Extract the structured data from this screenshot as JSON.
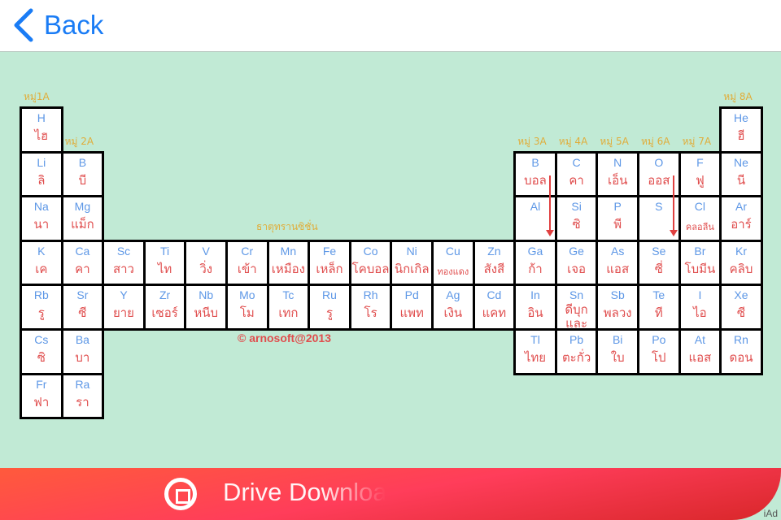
{
  "header": {
    "back_label": "Back"
  },
  "colors": {
    "accent": "#1a7cf5",
    "background": "#c1ead5",
    "symbol": "#5d97e6",
    "thai": "#e04e4e",
    "group_label": "#e0ad3a"
  },
  "group_labels": [
    {
      "text": "หมู่1A",
      "col": 1,
      "row": 1
    },
    {
      "text": "หมู่ 2A",
      "col": 2,
      "row": 2
    },
    {
      "text": "หมู่ 3A",
      "col": 13,
      "row": 2
    },
    {
      "text": "หมู่ 4A",
      "col": 14,
      "row": 2
    },
    {
      "text": "หมู่ 5A",
      "col": 15,
      "row": 2
    },
    {
      "text": "หมู่ 6A",
      "col": 16,
      "row": 2
    },
    {
      "text": "หมู่ 7A",
      "col": 17,
      "row": 2
    },
    {
      "text": "หมู่ 8A",
      "col": 18,
      "row": 1
    }
  ],
  "transition_label": "ธาตุทรานซิชั่น",
  "copyright": "© arnosoft@2013",
  "elements": [
    {
      "sym": "H",
      "th": "ไฮ",
      "col": 1,
      "row": 1
    },
    {
      "sym": "He",
      "th": "ฮี",
      "col": 18,
      "row": 1
    },
    {
      "sym": "Li",
      "th": "ลิ",
      "col": 1,
      "row": 2
    },
    {
      "sym": "B",
      "th": "บี",
      "col": 2,
      "row": 2
    },
    {
      "sym": "B",
      "th": "บอล",
      "col": 13,
      "row": 2
    },
    {
      "sym": "C",
      "th": "คา",
      "col": 14,
      "row": 2
    },
    {
      "sym": "N",
      "th": "เอ็น",
      "col": 15,
      "row": 2
    },
    {
      "sym": "O",
      "th": "ออส",
      "col": 16,
      "row": 2
    },
    {
      "sym": "F",
      "th": "ฟู",
      "col": 17,
      "row": 2
    },
    {
      "sym": "Ne",
      "th": "นี",
      "col": 18,
      "row": 2
    },
    {
      "sym": "Na",
      "th": "นา",
      "col": 1,
      "row": 3
    },
    {
      "sym": "Mg",
      "th": "แม็ก",
      "col": 2,
      "row": 3
    },
    {
      "sym": "Al",
      "th": "",
      "col": 13,
      "row": 3
    },
    {
      "sym": "Si",
      "th": "ซิ",
      "col": 14,
      "row": 3
    },
    {
      "sym": "P",
      "th": "พี",
      "col": 15,
      "row": 3
    },
    {
      "sym": "S",
      "th": "",
      "col": 16,
      "row": 3
    },
    {
      "sym": "Cl",
      "th": "คลอลีน",
      "col": 17,
      "row": 3,
      "small": true
    },
    {
      "sym": "Ar",
      "th": "อาร์",
      "col": 18,
      "row": 3
    },
    {
      "sym": "K",
      "th": "เค",
      "col": 1,
      "row": 4
    },
    {
      "sym": "Ca",
      "th": "คา",
      "col": 2,
      "row": 4
    },
    {
      "sym": "Sc",
      "th": "สาว",
      "col": 3,
      "row": 4
    },
    {
      "sym": "Ti",
      "th": "ไท",
      "col": 4,
      "row": 4
    },
    {
      "sym": "V",
      "th": "วิ่ง",
      "col": 5,
      "row": 4
    },
    {
      "sym": "Cr",
      "th": "เข้า",
      "col": 6,
      "row": 4
    },
    {
      "sym": "Mn",
      "th": "เหมือง",
      "col": 7,
      "row": 4
    },
    {
      "sym": "Fe",
      "th": "เหล็ก",
      "col": 8,
      "row": 4
    },
    {
      "sym": "Co",
      "th": "โคบอล",
      "col": 9,
      "row": 4
    },
    {
      "sym": "Ni",
      "th": "นิกเกิล",
      "col": 10,
      "row": 4
    },
    {
      "sym": "Cu",
      "th": "ทองแดง",
      "col": 11,
      "row": 4,
      "small": true
    },
    {
      "sym": "Zn",
      "th": "สังสี",
      "col": 12,
      "row": 4
    },
    {
      "sym": "Ga",
      "th": "ก้า",
      "col": 13,
      "row": 4
    },
    {
      "sym": "Ge",
      "th": "เจอ",
      "col": 14,
      "row": 4
    },
    {
      "sym": "As",
      "th": "แอส",
      "col": 15,
      "row": 4
    },
    {
      "sym": "Se",
      "th": "ซี่",
      "col": 16,
      "row": 4
    },
    {
      "sym": "Br",
      "th": "โบมีน",
      "col": 17,
      "row": 4
    },
    {
      "sym": "Kr",
      "th": "คลิบ",
      "col": 18,
      "row": 4
    },
    {
      "sym": "Rb",
      "th": "รู",
      "col": 1,
      "row": 5
    },
    {
      "sym": "Sr",
      "th": "ซี",
      "col": 2,
      "row": 5
    },
    {
      "sym": "Y",
      "th": "ยาย",
      "col": 3,
      "row": 5
    },
    {
      "sym": "Zr",
      "th": "เซอร์",
      "col": 4,
      "row": 5
    },
    {
      "sym": "Nb",
      "th": "หนีบ",
      "col": 5,
      "row": 5
    },
    {
      "sym": "Mo",
      "th": "โม",
      "col": 6,
      "row": 5
    },
    {
      "sym": "Tc",
      "th": "เทก",
      "col": 7,
      "row": 5
    },
    {
      "sym": "Ru",
      "th": "รู",
      "col": 8,
      "row": 5
    },
    {
      "sym": "Rh",
      "th": "โร",
      "col": 9,
      "row": 5
    },
    {
      "sym": "Pd",
      "th": "แพท",
      "col": 10,
      "row": 5
    },
    {
      "sym": "Ag",
      "th": "เงิน",
      "col": 11,
      "row": 5
    },
    {
      "sym": "Cd",
      "th": "แคท",
      "col": 12,
      "row": 5
    },
    {
      "sym": "In",
      "th": "อิน",
      "col": 13,
      "row": 5
    },
    {
      "sym": "Sn",
      "th": "ดีบุกและ",
      "col": 14,
      "row": 5,
      "wrap": true
    },
    {
      "sym": "Sb",
      "th": "พลวง",
      "col": 15,
      "row": 5
    },
    {
      "sym": "Te",
      "th": "ที",
      "col": 16,
      "row": 5
    },
    {
      "sym": "I",
      "th": "ไอ",
      "col": 17,
      "row": 5
    },
    {
      "sym": "Xe",
      "th": "ซี",
      "col": 18,
      "row": 5
    },
    {
      "sym": "Cs",
      "th": "ซิ",
      "col": 1,
      "row": 6
    },
    {
      "sym": "Ba",
      "th": "บา",
      "col": 2,
      "row": 6
    },
    {
      "sym": "Tl",
      "th": "ไทย",
      "col": 13,
      "row": 6
    },
    {
      "sym": "Pb",
      "th": "ตะกั่ว",
      "col": 14,
      "row": 6
    },
    {
      "sym": "Bi",
      "th": "ใบ",
      "col": 15,
      "row": 6
    },
    {
      "sym": "Po",
      "th": "โป",
      "col": 16,
      "row": 6
    },
    {
      "sym": "At",
      "th": "แอส",
      "col": 17,
      "row": 6
    },
    {
      "sym": "Rn",
      "th": "ดอน",
      "col": 18,
      "row": 6
    },
    {
      "sym": "Fr",
      "th": "ฟา",
      "col": 1,
      "row": 7
    },
    {
      "sym": "Ra",
      "th": "รา",
      "col": 2,
      "row": 7
    }
  ],
  "arrows": [
    {
      "col": 13,
      "row_from": 2,
      "row_to": 3
    },
    {
      "col": 16,
      "row_from": 2,
      "row_to": 3
    }
  ],
  "ad": {
    "text": "Drive Download",
    "badge": "iAd",
    "icon": "target-icon"
  }
}
